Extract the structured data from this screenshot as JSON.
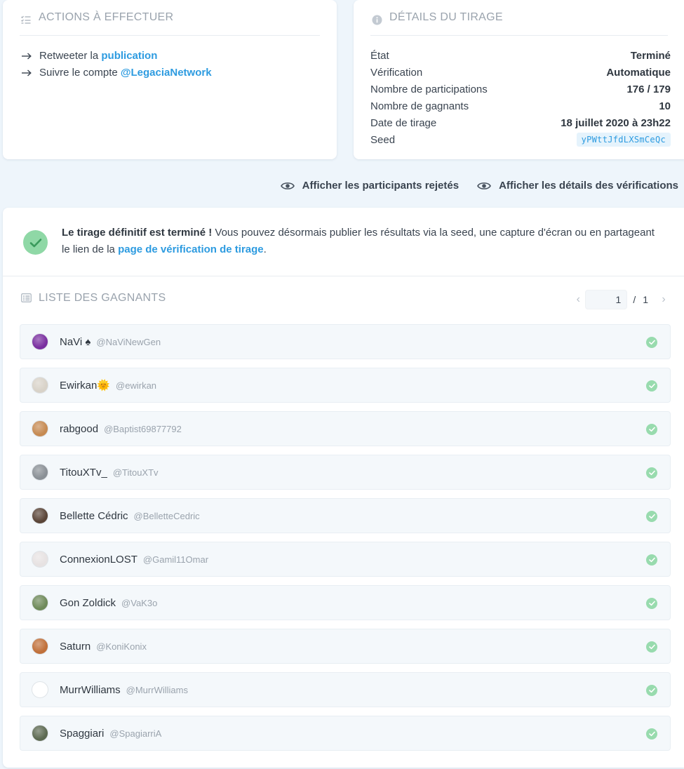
{
  "actions": {
    "title": "ACTIONS À EFFECTUER",
    "items": [
      {
        "prefix": "Retweeter la ",
        "link": "publication"
      },
      {
        "prefix": "Suivre le compte ",
        "link": "@LegaciaNetwork"
      }
    ]
  },
  "details": {
    "title": "DÉTAILS DU TIRAGE",
    "rows": [
      {
        "label": "État",
        "value": "Terminé"
      },
      {
        "label": "Vérification",
        "value": "Automatique"
      },
      {
        "label": "Nombre de participations",
        "value": "176 / 179"
      },
      {
        "label": "Nombre de gagnants",
        "value": "10"
      },
      {
        "label": "Date de tirage",
        "value": "18 juillet 2020 à 23h22"
      },
      {
        "label": "Seed",
        "value": "yPWttJfdLXSmCeQc"
      }
    ]
  },
  "toggles": {
    "rejected": "Afficher les participants rejetés",
    "verifications": "Afficher les détails des vérifications"
  },
  "notice": {
    "bold": "Le tirage définitif est terminé !",
    "text": " Vous pouvez désormais publier les résultats via la seed, une capture d'écran ou en partageant le lien de la ",
    "link": "page de vérification de tirage",
    "end": "."
  },
  "winners": {
    "title": "LISTE DES GAGNANTS",
    "page": "1",
    "separator": "/",
    "total_pages": "1",
    "prev_icon": "chevron-left-icon",
    "next_icon": "chevron-right-icon",
    "list": [
      {
        "name": "NaVi ♠",
        "handle": "@NaViNewGen",
        "avatar_color": "#7a2fa0"
      },
      {
        "name": "Ewirkan🌞",
        "handle": "@ewirkan",
        "avatar_color": "#d8d2c8"
      },
      {
        "name": "rabgood",
        "handle": "@Baptist69877792",
        "avatar_color": "#c68a52"
      },
      {
        "name": "TitouXTv_",
        "handle": "@TitouXTv",
        "avatar_color": "#8a9096"
      },
      {
        "name": "Bellette Cédric",
        "handle": "@BelletteCedric",
        "avatar_color": "#5a4538"
      },
      {
        "name": "ConnexionLOST",
        "handle": "@Gamil11Omar",
        "avatar_color": "#e7e2e2"
      },
      {
        "name": "Gon Zoldick",
        "handle": "@VaK3o",
        "avatar_color": "#6f8a5a"
      },
      {
        "name": "Saturn",
        "handle": "@KoniKonix",
        "avatar_color": "#c0703a"
      },
      {
        "name": "MurrWilliams",
        "handle": "@MurrWilliams",
        "avatar_color": "#ffffff"
      },
      {
        "name": "Spaggiari",
        "handle": "@SpagiarriA",
        "avatar_color": "#5d6a52"
      }
    ]
  },
  "colors": {
    "accent": "#2d9be0",
    "success": "#98dbae",
    "background": "#eef5fb"
  }
}
